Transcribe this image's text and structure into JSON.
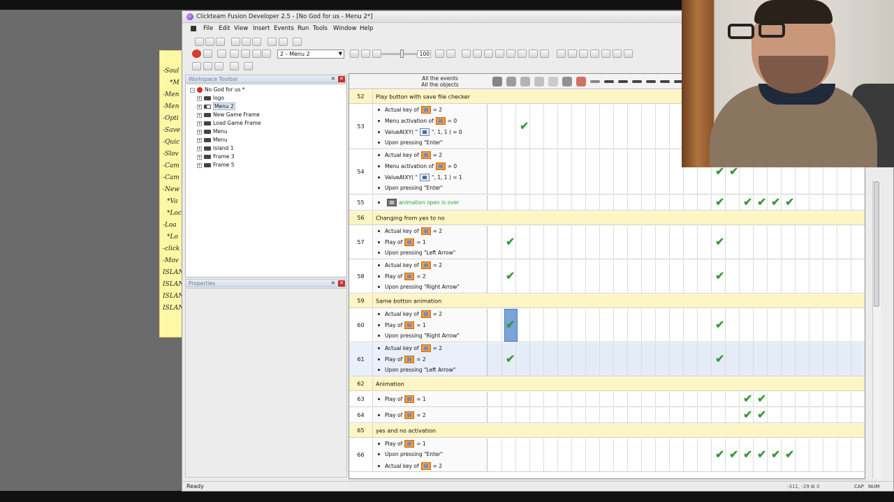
{
  "window": {
    "title": "Clickteam Fusion Developer 2.5 - [No God for us - Menu 2*]",
    "menu": [
      "File",
      "Edit",
      "View",
      "Insert",
      "Events",
      "Run",
      "Tools",
      "Window",
      "Help"
    ]
  },
  "toolbar": {
    "frame_select": "2 - Menu 2",
    "zoom_value": "100"
  },
  "sticky_note": {
    "lines": [
      "-Soul",
      "*M",
      "-Men",
      "-Men",
      "-Opti",
      "-Save",
      "-Quic",
      "-Slov",
      "-Cam",
      "-Cam",
      "-New",
      "*Va",
      "*Loc",
      "-Loa",
      "*Lo",
      "-click",
      "-Mov",
      "ISLAN",
      "ISLAN",
      "ISLAN",
      "ISLAN"
    ]
  },
  "workspace": {
    "header": "Workspace Toolbar",
    "app": "No God for us *",
    "frames": [
      "logo",
      "Menu 2",
      "New Game Frame",
      "Load Game Frame",
      "Menu",
      "Menu",
      "Island 1",
      "Frame 3",
      "Frame 5"
    ]
  },
  "properties": {
    "header": "Properties"
  },
  "editor": {
    "all_events": "All the events",
    "all_objects": "All the objects",
    "rows": [
      {
        "num": "52",
        "type": "comment",
        "text": "Play button with save file checker"
      },
      {
        "num": "53",
        "type": "event",
        "conds": [
          {
            "pre": "Actual key of",
            "obj": "orange",
            "post": "= 2"
          },
          {
            "pre": "Menu activation of",
            "obj": "orange",
            "post": "= 0"
          },
          {
            "pre": "ValueAtXY( \"",
            "obj": "arr",
            "post": "\", 1, 1 ) = 0"
          },
          {
            "pre": "Upon pressing \"Enter\"",
            "obj": "",
            "post": ""
          }
        ]
      },
      {
        "num": "54",
        "type": "event",
        "conds": [
          {
            "pre": "Actual key of",
            "obj": "orange",
            "post": "= 2"
          },
          {
            "pre": "Menu activation of",
            "obj": "orange",
            "post": "= 0"
          },
          {
            "pre": "ValueAtXY( \"",
            "obj": "arr",
            "post": "\", 1, 1 ) = 1"
          },
          {
            "pre": "Upon pressing \"Enter\"",
            "obj": "",
            "post": ""
          }
        ]
      },
      {
        "num": "55",
        "type": "event",
        "conds": [
          {
            "pre": "",
            "obj": "grey",
            "post": "animation open is over",
            "green": true
          }
        ]
      },
      {
        "num": "56",
        "type": "comment",
        "text": "Changing from yes to no"
      },
      {
        "num": "57",
        "type": "event",
        "conds": [
          {
            "pre": "Actual key of",
            "obj": "orange",
            "post": "= 2"
          },
          {
            "pre": "Play of",
            "obj": "orange",
            "post": "= 1"
          },
          {
            "pre": "Upon pressing \"Left Arrow\"",
            "obj": "",
            "post": ""
          }
        ]
      },
      {
        "num": "58",
        "type": "event",
        "conds": [
          {
            "pre": "Actual key of",
            "obj": "orange",
            "post": "= 2"
          },
          {
            "pre": "Play of",
            "obj": "orange",
            "post": "= 2"
          },
          {
            "pre": "Upon pressing \"Right Arrow\"",
            "obj": "",
            "post": ""
          }
        ]
      },
      {
        "num": "59",
        "type": "comment",
        "text": "Same botton animation"
      },
      {
        "num": "60",
        "type": "event",
        "conds": [
          {
            "pre": "Actual key of",
            "obj": "orange",
            "post": "= 2"
          },
          {
            "pre": "Play of",
            "obj": "orange",
            "post": "= 1"
          },
          {
            "pre": "Upon pressing \"Right Arrow\"",
            "obj": "",
            "post": ""
          }
        ]
      },
      {
        "num": "61",
        "type": "event",
        "conds": [
          {
            "pre": "Actual key of",
            "obj": "orange",
            "post": "= 2"
          },
          {
            "pre": "Play of",
            "obj": "orange",
            "post": "= 2"
          },
          {
            "pre": "Upon pressing \"Left Arrow\"",
            "obj": "",
            "post": ""
          }
        ]
      },
      {
        "num": "62",
        "type": "comment",
        "text": "Animation"
      },
      {
        "num": "63",
        "type": "event",
        "conds": [
          {
            "pre": "Play of",
            "obj": "orange",
            "post": "= 1"
          }
        ]
      },
      {
        "num": "64",
        "type": "event",
        "conds": [
          {
            "pre": "Play of",
            "obj": "orange",
            "post": "= 2"
          }
        ]
      },
      {
        "num": "65",
        "type": "comment",
        "text": "yes and no activation"
      },
      {
        "num": "66",
        "type": "event",
        "conds": [
          {
            "pre": "Play of",
            "obj": "orange",
            "post": "= 1"
          },
          {
            "pre": "Upon pressing \"Enter\"",
            "obj": "",
            "post": ""
          },
          {
            "pre": "Actual key of",
            "obj": "orange",
            "post": "= 2"
          }
        ]
      }
    ],
    "checks": {
      "53": [
        1
      ],
      "54": [
        15,
        16
      ],
      "55": [
        15,
        17,
        18,
        19,
        20
      ],
      "57": [
        0,
        15
      ],
      "58": [
        0,
        15
      ],
      "60": [
        0,
        15
      ],
      "61": [
        0,
        15
      ],
      "63": [
        17,
        18
      ],
      "64": [
        17,
        18
      ],
      "66": [
        15,
        16,
        17,
        18,
        19,
        20
      ]
    },
    "selected_row": "61"
  },
  "status": {
    "ready": "Ready",
    "coords": "-311, -29",
    "coords2": "0",
    "cap": "CAP",
    "num": "NUM"
  }
}
